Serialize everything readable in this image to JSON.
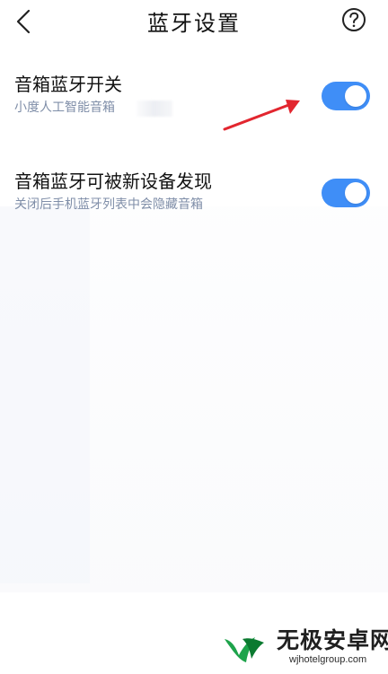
{
  "header": {
    "title": "蓝牙设置",
    "back_icon": "chevron-left-icon",
    "help_icon": "help-circle-icon"
  },
  "settings": [
    {
      "title": "音箱蓝牙开关",
      "subtitle": "小度人工智能音箱",
      "enabled": true
    },
    {
      "title": "音箱蓝牙可被新设备发现",
      "subtitle": "关闭后手机蓝牙列表中会隐藏音箱",
      "enabled": true
    }
  ],
  "annotation": {
    "arrow_icon": "red-arrow-icon",
    "color": "#e2262f"
  },
  "watermark": {
    "brand": "无极安卓网",
    "url": "wjhotelgroup.com"
  },
  "colors": {
    "toggle_on": "#3f8ef7",
    "subtitle": "#7f8ea8",
    "watermark_green": "#1ea34b"
  }
}
